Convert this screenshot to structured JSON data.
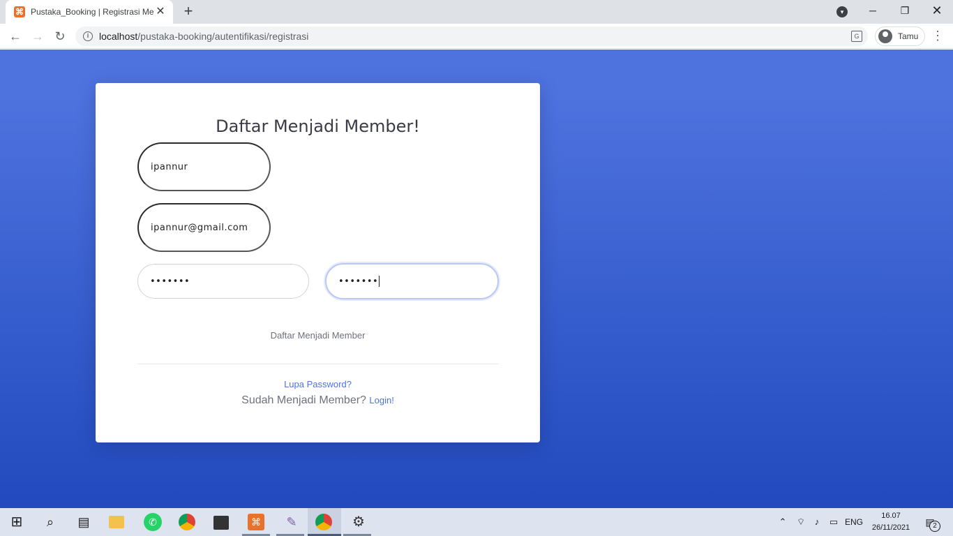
{
  "browser": {
    "tab_title": "Pustaka_Booking | Registrasi Member",
    "tab_favicon": "xampp-icon",
    "url_host": "localhost",
    "url_path": "/pustaka-booking/autentifikasi/registrasi",
    "profile_name": "Tamu"
  },
  "form": {
    "title": "Daftar Menjadi Member!",
    "name_value": "ipannur",
    "email_value": "ipannur@gmail.com",
    "password_value": "•••••••",
    "password_repeat_value": "•••••••",
    "submit_label": "Daftar Menjadi Member",
    "forgot_label": "Lupa Password?",
    "already_text": "Sudah Menjadi Member?",
    "login_label": "Login!"
  },
  "colors": {
    "gradient_top": "#4e73df",
    "gradient_bottom": "#224abe",
    "link": "#4e73df"
  },
  "taskbar": {
    "language": "ENG",
    "time": "16.07",
    "date": "26/11/2021",
    "notification_count": "2",
    "apps": [
      "start-icon",
      "search-icon",
      "task-view-icon",
      "file-explorer-icon",
      "whatsapp-icon",
      "chrome-icon",
      "store-icon",
      "xampp-icon",
      "paint-icon",
      "chrome-icon",
      "settings-icon"
    ]
  }
}
